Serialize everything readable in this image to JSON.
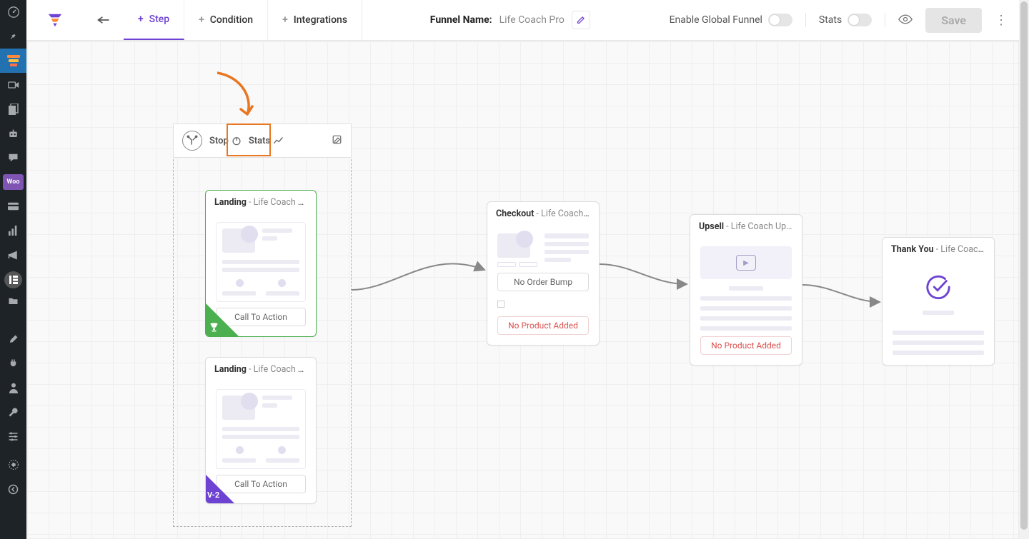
{
  "header": {
    "tabs": {
      "step": "Step",
      "condition": "Condition",
      "integrations": "Integrations"
    },
    "funnel_label": "Funnel Name:",
    "funnel_name": "Life Coach Pro",
    "global_label": "Enable Global Funnel",
    "stats_label": "Stats",
    "save_label": "Save"
  },
  "ab": {
    "stop_label": "Stop",
    "stats_label": "Stats"
  },
  "nodes": {
    "landing_a": {
      "type": "Landing",
      "name": " - Life Coach Lan…",
      "cta": "Call To Action"
    },
    "landing_b": {
      "type": "Landing",
      "name": " - Life Coach Lan…",
      "cta": "Call To Action",
      "badge": "V-2"
    },
    "checkout": {
      "type": "Checkout",
      "name": " - Life Coach Ch…",
      "bump": "No Order Bump",
      "warn": "No Product Added"
    },
    "upsell": {
      "type": "Upsell",
      "name": " - Life Coach Up…",
      "warn": "No Product Added"
    },
    "thankyou": {
      "type": "Thank You",
      "name": " - Life Coach Tha…"
    }
  }
}
